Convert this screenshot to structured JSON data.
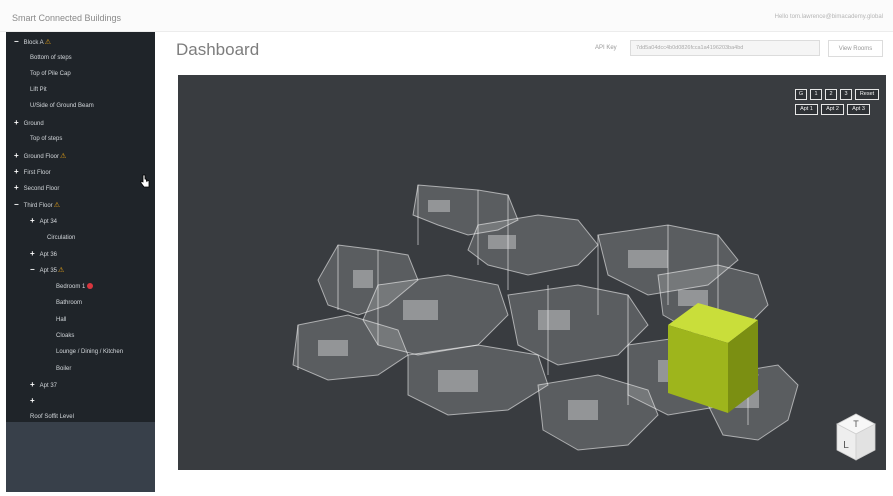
{
  "header": {
    "app_title": "Smart Connected Buildings",
    "user_greeting": "Hello tom.lawrence@bimacademy.global"
  },
  "tree": [
    {
      "label": "Block A",
      "glyph": "−",
      "warn": true
    },
    {
      "label": "Bottom of steps"
    },
    {
      "label": "Top of Pile Cap"
    },
    {
      "label": "Lift Pit"
    },
    {
      "label": "U/Side of Ground Beam"
    },
    {
      "label": "Ground",
      "glyph": "+"
    },
    {
      "label": "Top of steps"
    },
    {
      "label": "Ground Floor",
      "glyph": "+",
      "warn": true
    },
    {
      "label": "First Floor",
      "glyph": "+"
    },
    {
      "label": "Second Floor",
      "glyph": "+"
    },
    {
      "label": "Third Floor",
      "glyph": "−",
      "warn": true
    },
    {
      "label": "Apt 34",
      "glyph": "+"
    },
    {
      "label": "Circulation"
    },
    {
      "label": "Apt 36",
      "glyph": "+"
    },
    {
      "label": "Apt 35",
      "glyph": "−",
      "warn": true
    },
    {
      "label": "Bedroom 1",
      "error": true
    },
    {
      "label": "Bathroom"
    },
    {
      "label": "Hall"
    },
    {
      "label": "Cloaks"
    },
    {
      "label": "Lounge / Dining / Kitchen"
    },
    {
      "label": "Boiler"
    },
    {
      "label": "Apt 37",
      "glyph": "+"
    },
    {
      "label": "",
      "glyph": "+"
    },
    {
      "label": "Roof Soffit Level"
    }
  ],
  "main": {
    "page_title": "Dashboard",
    "api_key_label": "API Key",
    "api_key_value": "7dd5a04dcc4b0d0826fcca1a4196203ba4bd",
    "view_button": "View Rooms"
  },
  "viewer": {
    "floor_buttons": [
      "G",
      "1",
      "2",
      "3",
      "Reset"
    ],
    "apt_buttons": [
      "Apt 1",
      "Apt 2",
      "Apt 3"
    ],
    "viewcube_faces": [
      "T",
      "L"
    ],
    "highlight_color": "#a4c21a",
    "background_color": "#393c40"
  },
  "icons": {
    "warning": "warning-triangle-icon",
    "error": "error-dot-icon",
    "expand": "plus-icon",
    "collapse": "minus-icon",
    "cursor": "hand-cursor-icon"
  }
}
